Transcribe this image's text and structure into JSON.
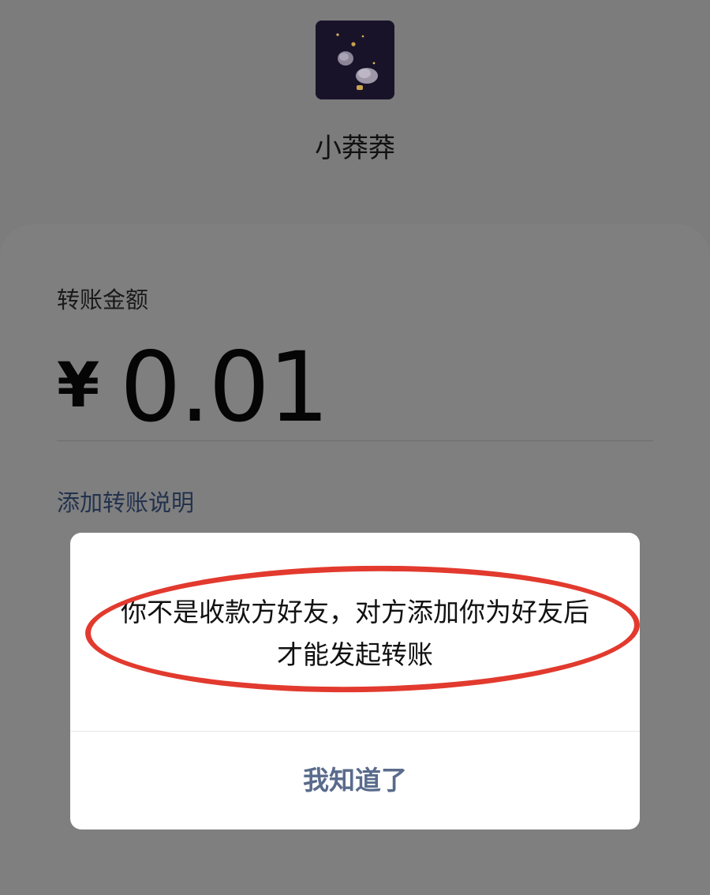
{
  "payee": {
    "name": "小莽莽"
  },
  "transfer": {
    "amount_label": "转账金额",
    "currency_symbol": "¥",
    "amount": "0.01",
    "remark_link": "添加转账说明"
  },
  "dialog": {
    "message": "你不是收款方好友，对方添加你为好友后才能发起转账",
    "button": "我知道了"
  },
  "colors": {
    "overlay": "#7c7c7c",
    "dialog_background": "#ffffff",
    "button_text": "#5a6b8c",
    "highlight_ellipse": "#e23a2e"
  }
}
